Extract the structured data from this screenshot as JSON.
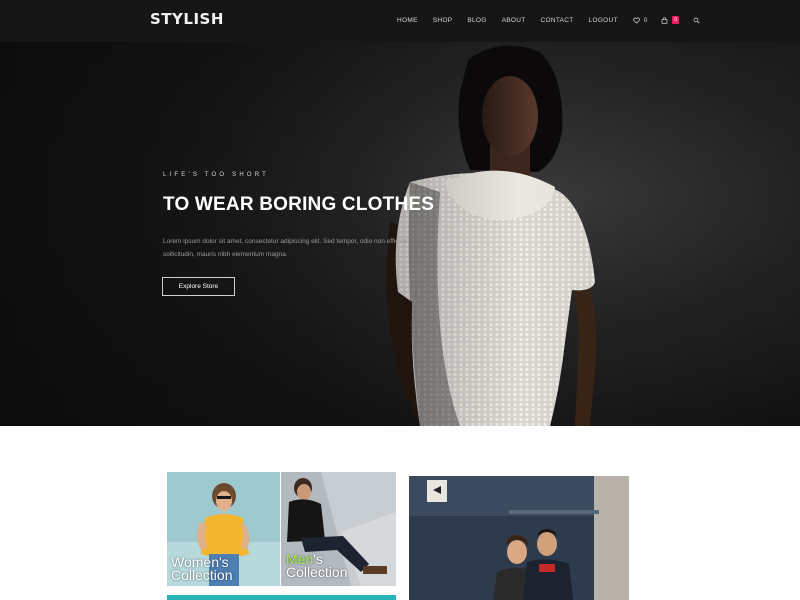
{
  "header": {
    "logo": "STYLISH",
    "nav": [
      "HOME",
      "SHOP",
      "BLOG",
      "ABOUT",
      "CONTACT",
      "LOGOUT"
    ],
    "wishlist_count": "0",
    "cart_count": "0",
    "icons": [
      "heart-icon",
      "bag-icon",
      "search-icon"
    ]
  },
  "hero": {
    "eyebrow": "LIFE'S TOO SHORT",
    "headline": "TO WEAR BORING CLOTHES",
    "lede": "Lorem ipsum dolor sit amet, consectetur adipiscing elit. Sed tempor, odio non efficitur sollicitudin, mauris nibh elementum magna.",
    "cta": "Explore Store"
  },
  "collections": {
    "women": {
      "line1": "Women's",
      "line2": "Collection"
    },
    "men": {
      "line1_accent": "Men",
      "line1_rest": "'s",
      "line2": "Collection"
    }
  },
  "colors": {
    "header_bg": "#161617",
    "badge": "#e91e63",
    "label_accent": "#a6f13c",
    "teal": "#27b3b9"
  }
}
